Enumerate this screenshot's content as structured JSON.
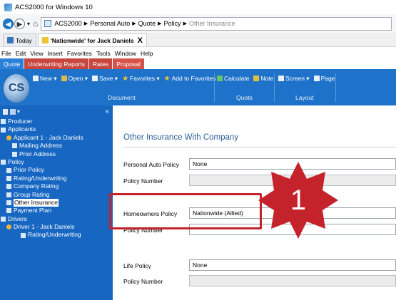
{
  "window": {
    "title": "ACS2000 for Windows 10"
  },
  "breadcrumb": [
    "ACS2000",
    "Personal Auto",
    "Quote",
    "Policy",
    "Other Insurance"
  ],
  "doc_tabs": [
    {
      "label": "Today"
    },
    {
      "label": "'Nationwide' for Jack Daniels",
      "close": "X"
    }
  ],
  "menu": [
    "File",
    "Edit",
    "View",
    "Insert",
    "Favorites",
    "Tools",
    "Window",
    "Help"
  ],
  "ribbon_tabs": [
    "Quote",
    "Underwriting Reports",
    "Rates",
    "Proposal"
  ],
  "ribbon": {
    "document_buttons": [
      "New ▾",
      "Open ▾",
      "Save ▾",
      "Favorites ▾",
      "Add to Favorites"
    ],
    "quote_buttons": [
      "Calculate",
      "Note"
    ],
    "layout_buttons": [
      "Screen ▾",
      "Page"
    ],
    "groups": [
      "Document",
      "Quote",
      "Layout"
    ]
  },
  "sidebar": {
    "collapse_glyph": "«",
    "items": [
      {
        "label": "Producer",
        "level": 0
      },
      {
        "label": "Applicants",
        "level": 0
      },
      {
        "label": "Applicant 1 - Jack Daniels",
        "level": 1,
        "icon": "person"
      },
      {
        "label": "Mailing Address",
        "level": 2
      },
      {
        "label": "Prior Address",
        "level": 2
      },
      {
        "label": "Policy",
        "level": 0
      },
      {
        "label": "Prior Policy",
        "level": 1
      },
      {
        "label": "Rating/Underwriting",
        "level": 1
      },
      {
        "label": "Company Rating",
        "level": 1
      },
      {
        "label": "Group Rating",
        "level": 1
      },
      {
        "label": "Other Insurance",
        "level": 1,
        "selected": true
      },
      {
        "label": "Payment Plan",
        "level": 1
      },
      {
        "label": "Drivers",
        "level": 0
      },
      {
        "label": "Driver 1 - Jack Daniels",
        "level": 1,
        "icon": "person"
      },
      {
        "label": "Rating/Underwriting",
        "level": 3
      }
    ]
  },
  "main": {
    "section_title": "Other Insurance With Company",
    "fields": {
      "personal_auto_policy": {
        "label": "Personal Auto Policy",
        "value": "None"
      },
      "personal_auto_policy_number": {
        "label": "Policy Number",
        "value": ""
      },
      "homeowners_policy": {
        "label": "Homeowners Policy",
        "value": "Nationwide (Allied)"
      },
      "homeowners_policy_number": {
        "label": "Policy Number",
        "value": ""
      },
      "life_policy": {
        "label": "Life Policy",
        "value": "None"
      },
      "life_policy_number": {
        "label": "Policy Number",
        "value": ""
      }
    }
  },
  "callout": {
    "number": "1",
    "color": "#c4232c"
  }
}
